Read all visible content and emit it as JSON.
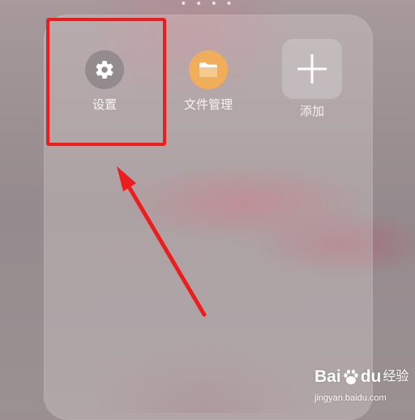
{
  "folder": {
    "apps": [
      {
        "label": "设置",
        "icon": "gear-icon",
        "color": "#938b8d"
      },
      {
        "label": "文件管理",
        "icon": "folder-icon",
        "color": "#f0ad5a"
      },
      {
        "label": "添加",
        "icon": "plus-icon",
        "color": "#cdc8ca"
      }
    ]
  },
  "annotation": {
    "highlight_color": "#ee1d1d",
    "arrow_color": "#ee1d1d"
  },
  "watermark": {
    "brand_latin_1": "Bai",
    "brand_latin_2": "du",
    "brand_cn": "经验",
    "url": "jingyan.baidu.com",
    "icon": "baidu-paw-icon"
  }
}
